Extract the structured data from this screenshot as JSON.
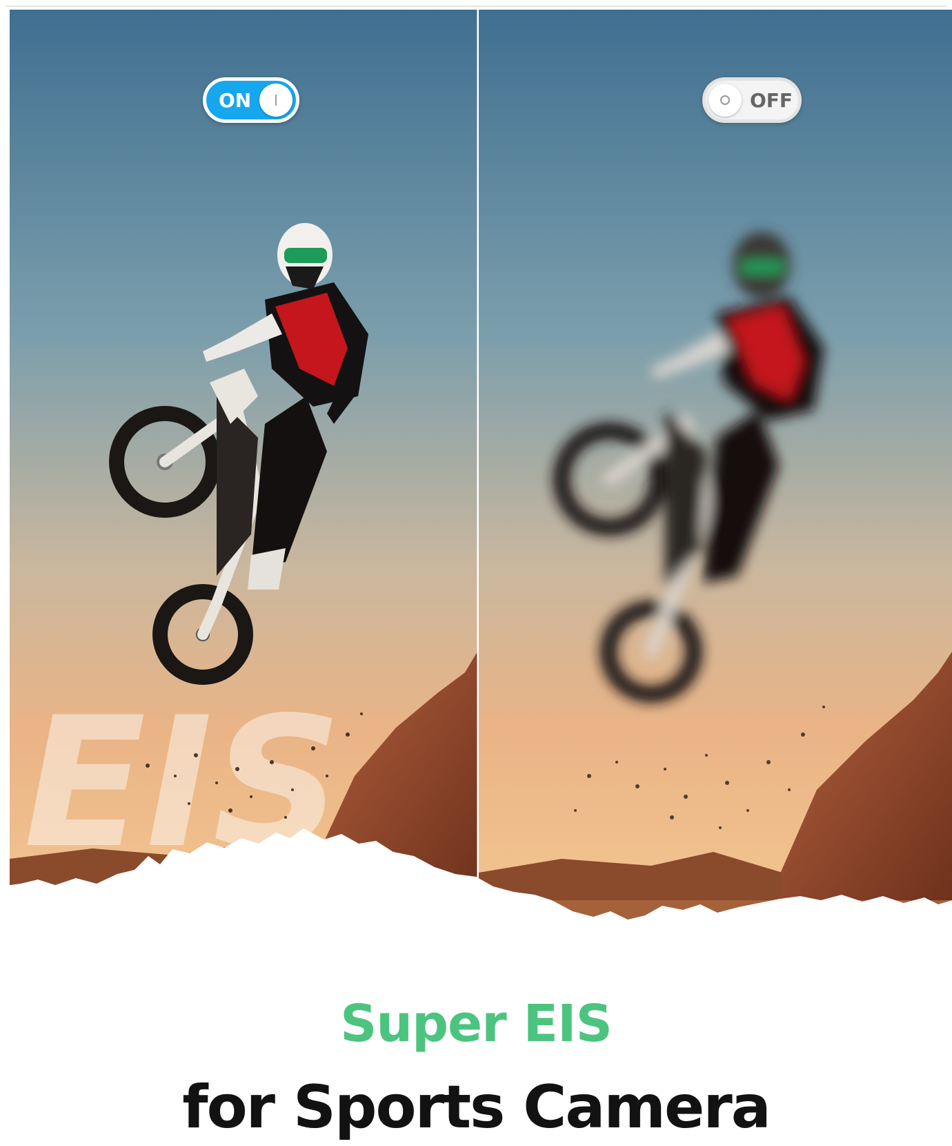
{
  "left_panel": {
    "toggle_label": "ON",
    "toggle_state": "on",
    "accent_color": "#17a7ee"
  },
  "right_panel": {
    "toggle_label": "OFF",
    "toggle_state": "off"
  },
  "watermark_text": "EIS",
  "headline": {
    "title": "Super EIS",
    "title_color": "#4cc47f",
    "subtitle": "for Sports Camera",
    "subtitle_color": "#121212"
  }
}
